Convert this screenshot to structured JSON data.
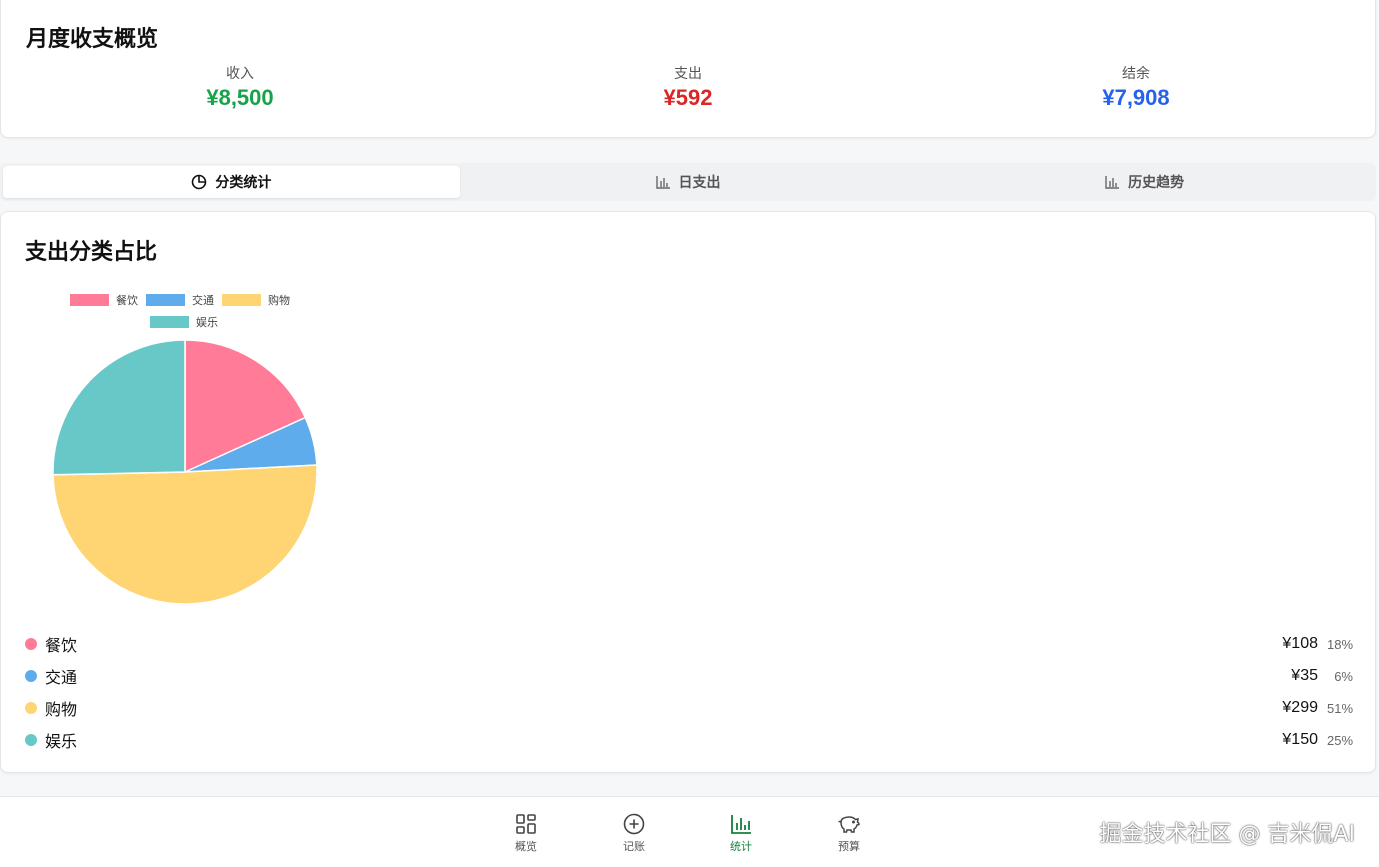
{
  "summary": {
    "title": "月度收支概览",
    "income_label": "收入",
    "income_value": "¥8,500",
    "expense_label": "支出",
    "expense_value": "¥592",
    "balance_label": "结余",
    "balance_value": "¥7,908",
    "colors": {
      "income": "#16a34a",
      "expense": "#dc2626",
      "balance": "#2563eb"
    }
  },
  "tabs": [
    {
      "label": "分类统计",
      "icon": "pie-chart-icon",
      "active": true
    },
    {
      "label": "日支出",
      "icon": "bar-chart-icon",
      "active": false
    },
    {
      "label": "历史趋势",
      "icon": "bar-chart-icon",
      "active": false
    }
  ],
  "chart_card": {
    "title": "支出分类占比"
  },
  "chart_data": {
    "type": "pie",
    "categories": [
      "餐饮",
      "交通",
      "购物",
      "娱乐"
    ],
    "values": [
      108,
      35,
      299,
      150
    ],
    "colors": [
      "#ff7b97",
      "#5eacec",
      "#ffd473",
      "#68c8c7"
    ],
    "legend_position": "top"
  },
  "breakdown": [
    {
      "name": "餐饮",
      "amount": "¥108",
      "percent": "18%",
      "color": "#ff7b97"
    },
    {
      "name": "交通",
      "amount": "¥35",
      "percent": "6%",
      "color": "#5eacec"
    },
    {
      "name": "购物",
      "amount": "¥299",
      "percent": "51%",
      "color": "#ffd473"
    },
    {
      "name": "娱乐",
      "amount": "¥150",
      "percent": "25%",
      "color": "#68c8c7"
    }
  ],
  "nav": [
    {
      "label": "概览",
      "icon": "grid-icon",
      "active": false
    },
    {
      "label": "记账",
      "icon": "plus-circle-icon",
      "active": false
    },
    {
      "label": "统计",
      "icon": "bar-chart-icon",
      "active": true
    },
    {
      "label": "预算",
      "icon": "piggy-bank-icon",
      "active": false
    }
  ],
  "watermark": "掘金技术社区 @ 吉米侃AI",
  "accent_color": "#15803d"
}
